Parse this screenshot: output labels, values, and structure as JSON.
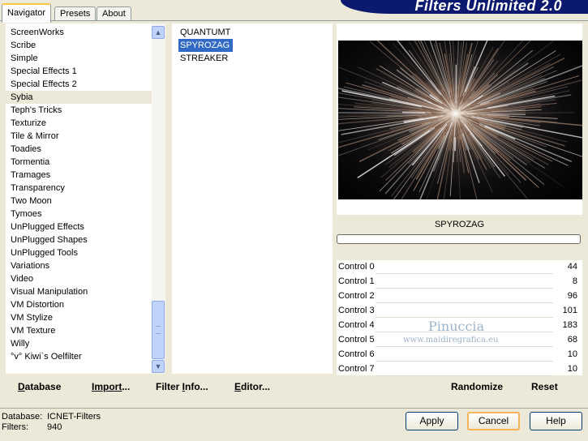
{
  "tabs": [
    {
      "label": "Navigator"
    },
    {
      "label": "Presets"
    },
    {
      "label": "About"
    }
  ],
  "banner_title": "Filters Unlimited 2.0",
  "categories": [
    "ScreenWorks",
    "Scribe",
    "Simple",
    "Special Effects 1",
    "Special Effects 2",
    "Sybia",
    "Teph's Tricks",
    "Texturize",
    "Tile & Mirror",
    "Toadies",
    "Tormentia",
    "Tramages",
    "Transparency",
    "Two Moon",
    "Tymoes",
    "UnPlugged Effects",
    "UnPlugged Shapes",
    "UnPlugged Tools",
    "Variations",
    "Video",
    "Visual Manipulation",
    "VM Distortion",
    "VM Stylize",
    "VM Texture",
    "Willy",
    "°v° Kiwi`s Oelfilter"
  ],
  "selected_category": "Sybia",
  "filters": [
    "QUANTUMT",
    "SPYROZAG",
    "STREAKER"
  ],
  "selected_filter": "SPYROZAG",
  "filter_name": "SPYROZAG",
  "controls": [
    {
      "label": "Control 0",
      "value": "44"
    },
    {
      "label": "Control 1",
      "value": "8"
    },
    {
      "label": "Control 2",
      "value": "96"
    },
    {
      "label": "Control 3",
      "value": "101"
    },
    {
      "label": "Control 4",
      "value": "183"
    },
    {
      "label": "Control 5",
      "value": "68"
    },
    {
      "label": "Control 6",
      "value": "10"
    },
    {
      "label": "Control 7",
      "value": "10"
    }
  ],
  "watermark": {
    "name": "Pinuccia",
    "site": "www.maidiregrafica.eu"
  },
  "left_buttons": {
    "database": {
      "u": "D",
      "rest": "atabase"
    },
    "import": {
      "pre": "Import",
      "u": "",
      "rest": "..."
    },
    "filter_info": {
      "pre": "Filter ",
      "u": "I",
      "rest": "nfo..."
    },
    "editor": {
      "u": "E",
      "rest": "ditor..."
    }
  },
  "randomize_label": "Randomize",
  "reset_label": "Reset",
  "info": {
    "database_label": "Database:",
    "database_value": "ICNET-Filters",
    "filters_label": "Filters:",
    "filters_value": "940"
  },
  "dialog_buttons": {
    "apply": "Apply",
    "cancel": "Cancel",
    "help": "Help"
  },
  "scroll": {
    "up_icon": "chevron-up-icon",
    "down_icon": "chevron-down-icon"
  }
}
